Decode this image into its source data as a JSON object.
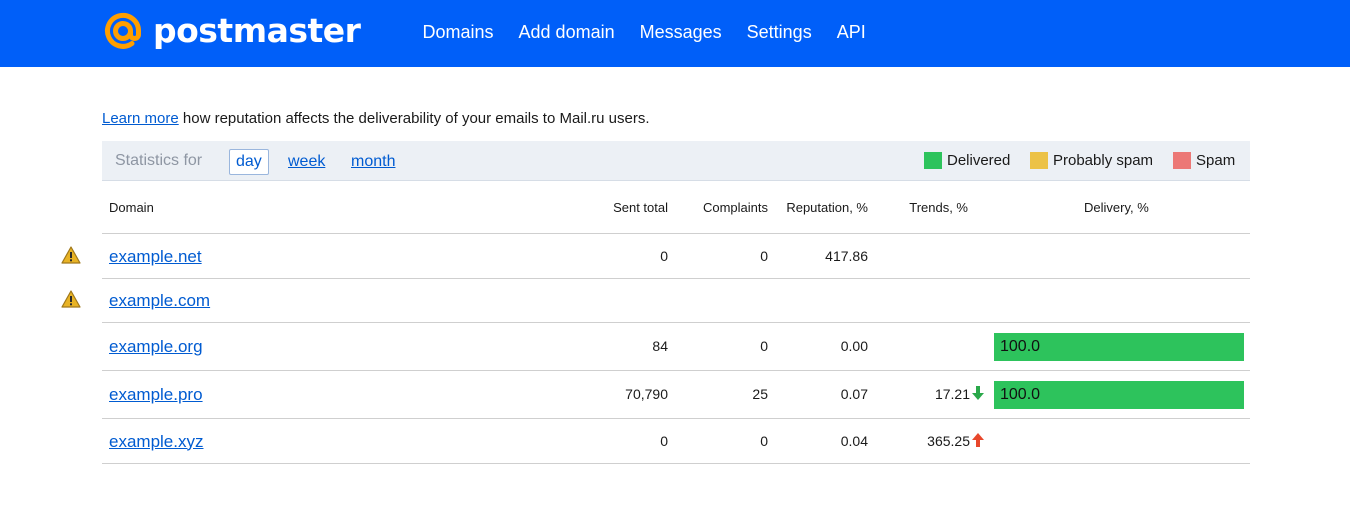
{
  "brand": {
    "name": "postmaster"
  },
  "nav": [
    "Domains",
    "Add domain",
    "Messages",
    "Settings",
    "API"
  ],
  "intro": {
    "link": "Learn more",
    "text": " how reputation affects the deliverability of your emails to Mail.ru users."
  },
  "stats": {
    "label": "Statistics for",
    "periods": [
      "day",
      "week",
      "month"
    ],
    "active_period": "day"
  },
  "legend": [
    {
      "label": "Delivered",
      "color": "#2dc35c"
    },
    {
      "label": "Probably spam",
      "color": "#ecc246"
    },
    {
      "label": "Spam",
      "color": "#ec7876"
    }
  ],
  "columns": {
    "domain": "Domain",
    "sent": "Sent total",
    "complaints": "Complaints",
    "reputation": "Reputation, %",
    "trends": "Trends, %",
    "delivery": "Delivery, %"
  },
  "rows": [
    {
      "domain": "example.net",
      "warning": true,
      "sent": "0",
      "complaints": "0",
      "reputation": "417.86",
      "trend": "",
      "trend_dir": "",
      "delivery": ""
    },
    {
      "domain": "example.com",
      "warning": true,
      "sent": "",
      "complaints": "",
      "reputation": "",
      "trend": "",
      "trend_dir": "",
      "delivery": ""
    },
    {
      "domain": "example.org",
      "warning": false,
      "sent": "84",
      "complaints": "0",
      "reputation": "0.00",
      "trend": "",
      "trend_dir": "",
      "delivery": "100.0"
    },
    {
      "domain": "example.pro",
      "warning": false,
      "sent": "70,790",
      "complaints": "25",
      "reputation": "0.07",
      "trend": "17.21",
      "trend_dir": "down",
      "delivery": "100.0"
    },
    {
      "domain": "example.xyz",
      "warning": false,
      "sent": "0",
      "complaints": "0",
      "reputation": "0.04",
      "trend": "365.25",
      "trend_dir": "up",
      "delivery": ""
    }
  ],
  "colors": {
    "header": "#005ff9",
    "logo_accent": "#ff9e00",
    "trend_down": "#2aa84a",
    "trend_up": "#e8472b"
  }
}
